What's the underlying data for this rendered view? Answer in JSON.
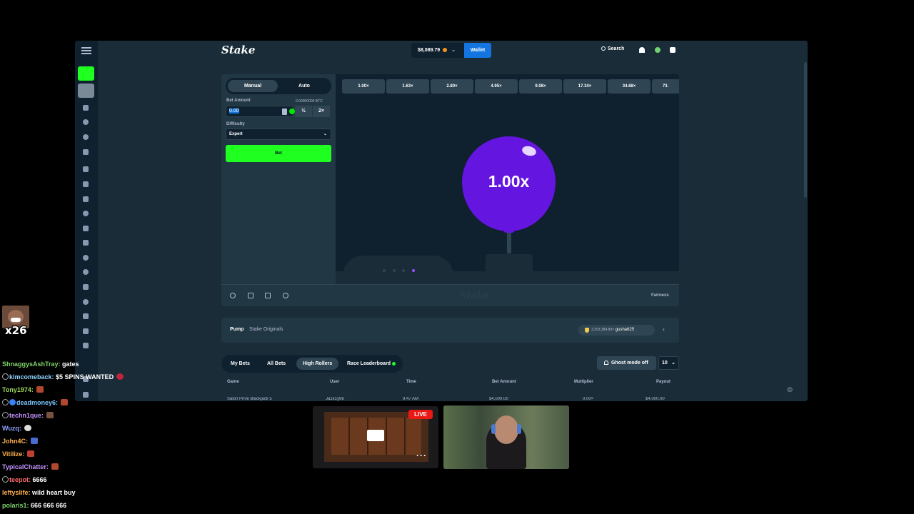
{
  "topbar": {
    "logo": "Stake",
    "balance": "$8,089.79",
    "wallet_label": "Wallet",
    "search_label": "Search"
  },
  "controls": {
    "tab_manual": "Manual",
    "tab_auto": "Auto",
    "bet_amount_label": "Bet Amount",
    "bet_amount_crypto": "0.00000000 BTC",
    "bet_amount_value": "0.00",
    "half_label": "½",
    "double_label": "2×",
    "difficulty_label": "Difficulty",
    "difficulty_value": "Expert",
    "bet_button": "Bet"
  },
  "game": {
    "multipliers": [
      "1.00×",
      "1.63×",
      "2.80×",
      "4.95×",
      "9.08×",
      "17.34×",
      "34.68×",
      "73."
    ],
    "current_multiplier": "1.00x",
    "footer_watermark": "Stake",
    "fairness_label": "Fairness"
  },
  "info": {
    "title": "Pump",
    "subtitle": "Stake Originals",
    "leader_amount": "3,203,384.89×",
    "leader_user": "gusha625"
  },
  "bets": {
    "tabs": [
      "My Bets",
      "All Bets",
      "High Rollers",
      "Race Leaderboard"
    ],
    "active_tab": "High Rollers",
    "ghost_mode": "Ghost mode off",
    "count": "10",
    "columns": [
      "Game",
      "User",
      "Time",
      "Bet Amount",
      "Multiplier",
      "Payout"
    ],
    "rows": [
      {
        "game": "Salon Privé Blackjack 5",
        "user": "Ja1k1y96",
        "time": "9:47 AM",
        "bet": "$4,000.00",
        "multiplier": "0.00×",
        "payout": "$4,000.00"
      }
    ]
  },
  "stream": {
    "multiplier_badge": "x26",
    "live_label": "LIVE",
    "more_label": "···"
  },
  "chat": [
    {
      "user": "ShnaggysAshTray:",
      "text": "gates",
      "color": "#7fd46a"
    },
    {
      "user": "kimcomeback:",
      "text": "$5 SPINS WANTED",
      "color": "#8fd3ff"
    },
    {
      "user": "Tony1974:",
      "text": "",
      "color": "#9dd85c"
    },
    {
      "user": "deadmoney6:",
      "text": "",
      "color": "#7cc6ff"
    },
    {
      "user": "techn1que:",
      "text": "",
      "color": "#c493ff"
    },
    {
      "user": "Wuzq:",
      "text": "",
      "color": "#8fa3ff"
    },
    {
      "user": "John4C:",
      "text": "",
      "color": "#ffb04f"
    },
    {
      "user": "Vitilize:",
      "text": "",
      "color": "#ffb04f"
    },
    {
      "user": "TypicalChatter:",
      "text": "",
      "color": "#c493ff"
    },
    {
      "user": "teepot:",
      "text": "6666",
      "color": "#ff6b6b"
    },
    {
      "user": "leftyslife:",
      "text": "wild heart buy",
      "color": "#ffb04f"
    },
    {
      "user": "polaris1:",
      "text": "666 666 666",
      "color": "#7fd46a"
    }
  ],
  "colors": {
    "accent_green": "#1fff20",
    "balloon": "#6415e0",
    "wallet_blue": "#1475e1",
    "bg_dark": "#0f212e",
    "panel": "#213743"
  }
}
